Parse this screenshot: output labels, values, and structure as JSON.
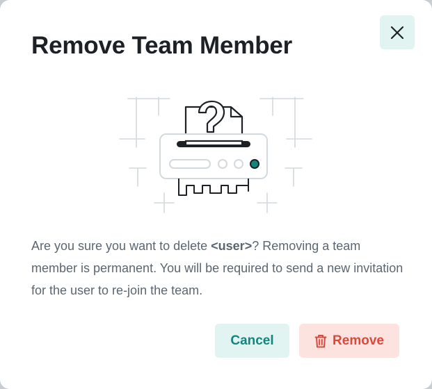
{
  "dialog": {
    "title": "Remove Team Member",
    "message": {
      "before": "Are you sure you want to delete ",
      "user_placeholder": "<user>",
      "after": "? Removing a team member is permanent. You will be required to send a new invitation for the user to re-join the team."
    },
    "buttons": {
      "cancel_label": "Cancel",
      "remove_label": "Remove"
    },
    "icons": {
      "close": "close-icon",
      "remove": "trash-icon",
      "illustration": "document-shredder-illustration"
    }
  },
  "colors": {
    "accent": "#14857c",
    "accent_bg": "#e2f4f2",
    "danger": "#d94a3d",
    "danger_bg": "#fde3df",
    "title": "#1d2125",
    "body_text": "#5c6670"
  }
}
